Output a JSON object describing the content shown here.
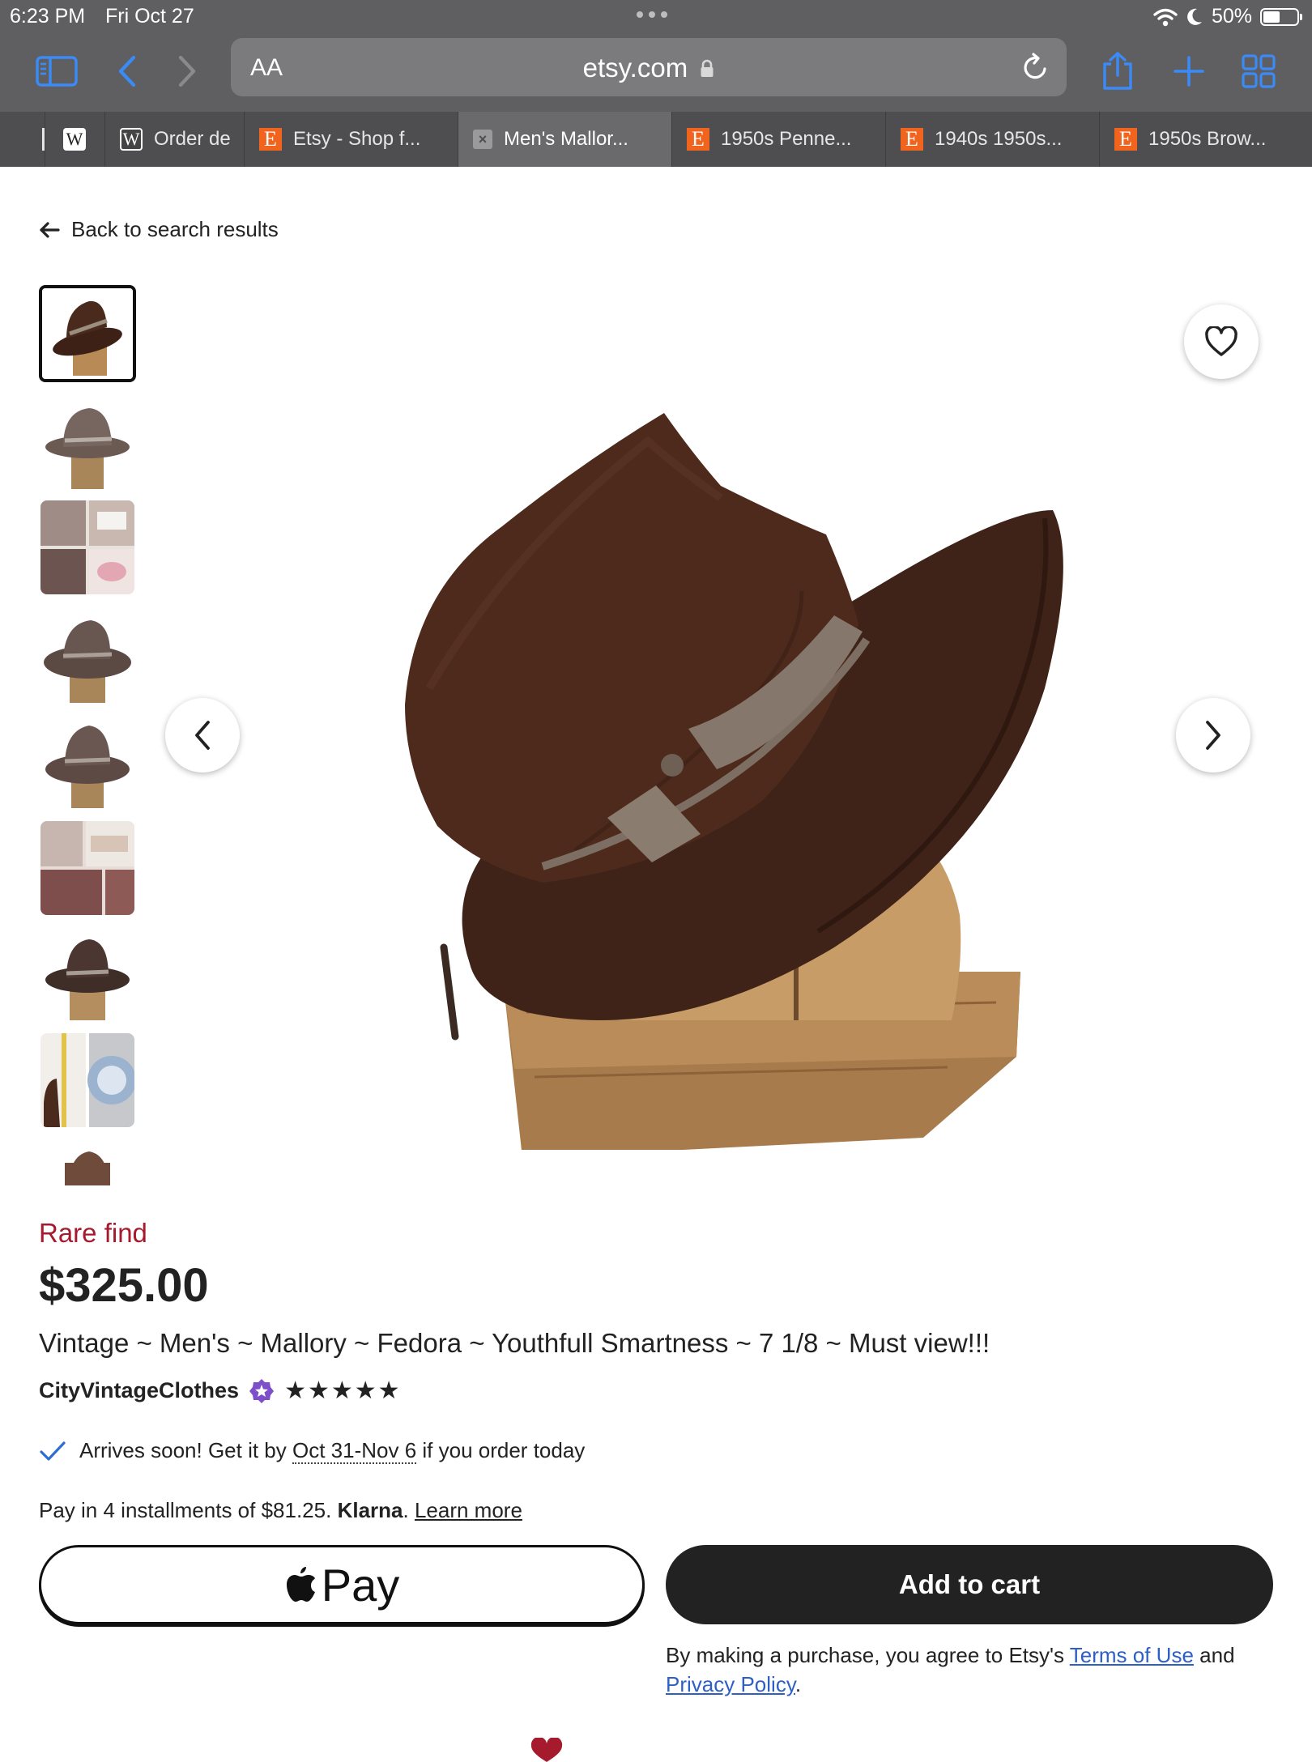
{
  "status_bar": {
    "time": "6:23 PM",
    "date": "Fri Oct 27",
    "battery": "50%"
  },
  "browser": {
    "address": {
      "aa_label": "AA",
      "url": "etsy.com"
    },
    "tabs": [
      {
        "label": "",
        "favicon": "tab-edge"
      },
      {
        "label": "",
        "favicon": "W"
      },
      {
        "label": "Order de",
        "favicon": "W"
      },
      {
        "label": "Etsy - Shop f...",
        "favicon": "E"
      },
      {
        "label": "Men's Mallor...",
        "favicon": "close",
        "active": true
      },
      {
        "label": "1950s Penne...",
        "favicon": "E"
      },
      {
        "label": "1940s 1950s...",
        "favicon": "E"
      },
      {
        "label": "1950s Brow...",
        "favicon": "E"
      }
    ]
  },
  "page": {
    "back_link": "Back to search results",
    "rare_find": "Rare find",
    "price": "$325.00",
    "title": "Vintage ~ Men's ~ Mallory ~ Fedora ~ Youthfull Smartness ~ 7 1/8 ~ Must view!!!",
    "shop_name": "CityVintageClothes",
    "rating_stars": 5,
    "stars_text": "★★★★★",
    "delivery": {
      "prefix": "Arrives soon! Get it by",
      "dates": "Oct 31-Nov 6",
      "suffix": "if you order today"
    },
    "klarna": {
      "prefix": "Pay in 4 installments of $81.25.",
      "brand": "Klarna",
      "dot": ".",
      "learn_more": "Learn more"
    },
    "apple_pay_label": "Pay",
    "add_to_cart": "Add to cart",
    "legal": {
      "prefix": "By making a purchase, you agree to Etsy's",
      "terms": "Terms of Use",
      "and": "and",
      "privacy": "Privacy Policy",
      "end": "."
    }
  },
  "colors": {
    "browser_chrome": "#5f5f62",
    "tab_bar": "#4e4e51",
    "etsy_orange": "#f1641e",
    "rare_find_red": "#a61a2e",
    "link_blue": "#2d5fc4",
    "hat_brown": "#4a2a1c",
    "button_dark": "#222222"
  }
}
